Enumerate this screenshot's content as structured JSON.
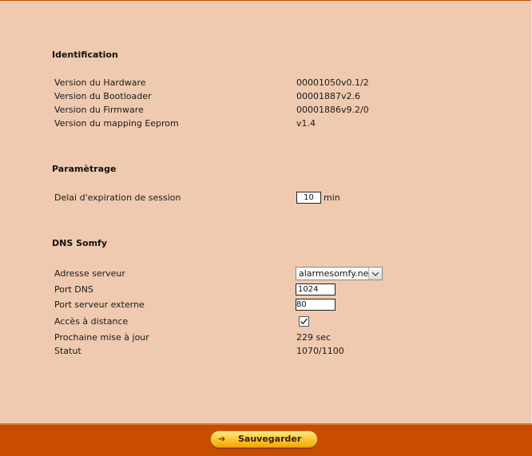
{
  "identification": {
    "title": "Identification",
    "rows": [
      {
        "label": "Version du Hardware",
        "value": "00001050v0.1/2"
      },
      {
        "label": "Version du Bootloader",
        "value": "00001887v2.6"
      },
      {
        "label": "Version du Firmware",
        "value": "00001886v9.2/0"
      },
      {
        "label": "Version du mapping Eeprom",
        "value": "v1.4"
      }
    ]
  },
  "parametrage": {
    "title": "Paramètrage",
    "session_label": "Delai d'expiration de session",
    "session_value": "10",
    "session_unit": "min"
  },
  "dns": {
    "title": "DNS Somfy",
    "server_label": "Adresse serveur",
    "server_value": "alarmesomfy.net",
    "port_dns_label": "Port DNS",
    "port_dns_value": "1024",
    "port_ext_label": "Port serveur externe",
    "port_ext_value": "80",
    "remote_label": "Accès à distance",
    "remote_checked": true,
    "next_update_label": "Prochaine mise à jour",
    "next_update_value": "229 sec",
    "status_label": "Statut",
    "status_value": "1070/1100"
  },
  "footer": {
    "save_label": "Sauvegarder",
    "save_icon": "arrow-right-icon"
  },
  "colors": {
    "background": "#efcab0",
    "footer": "#c94d00",
    "button": "#ffc93a"
  }
}
